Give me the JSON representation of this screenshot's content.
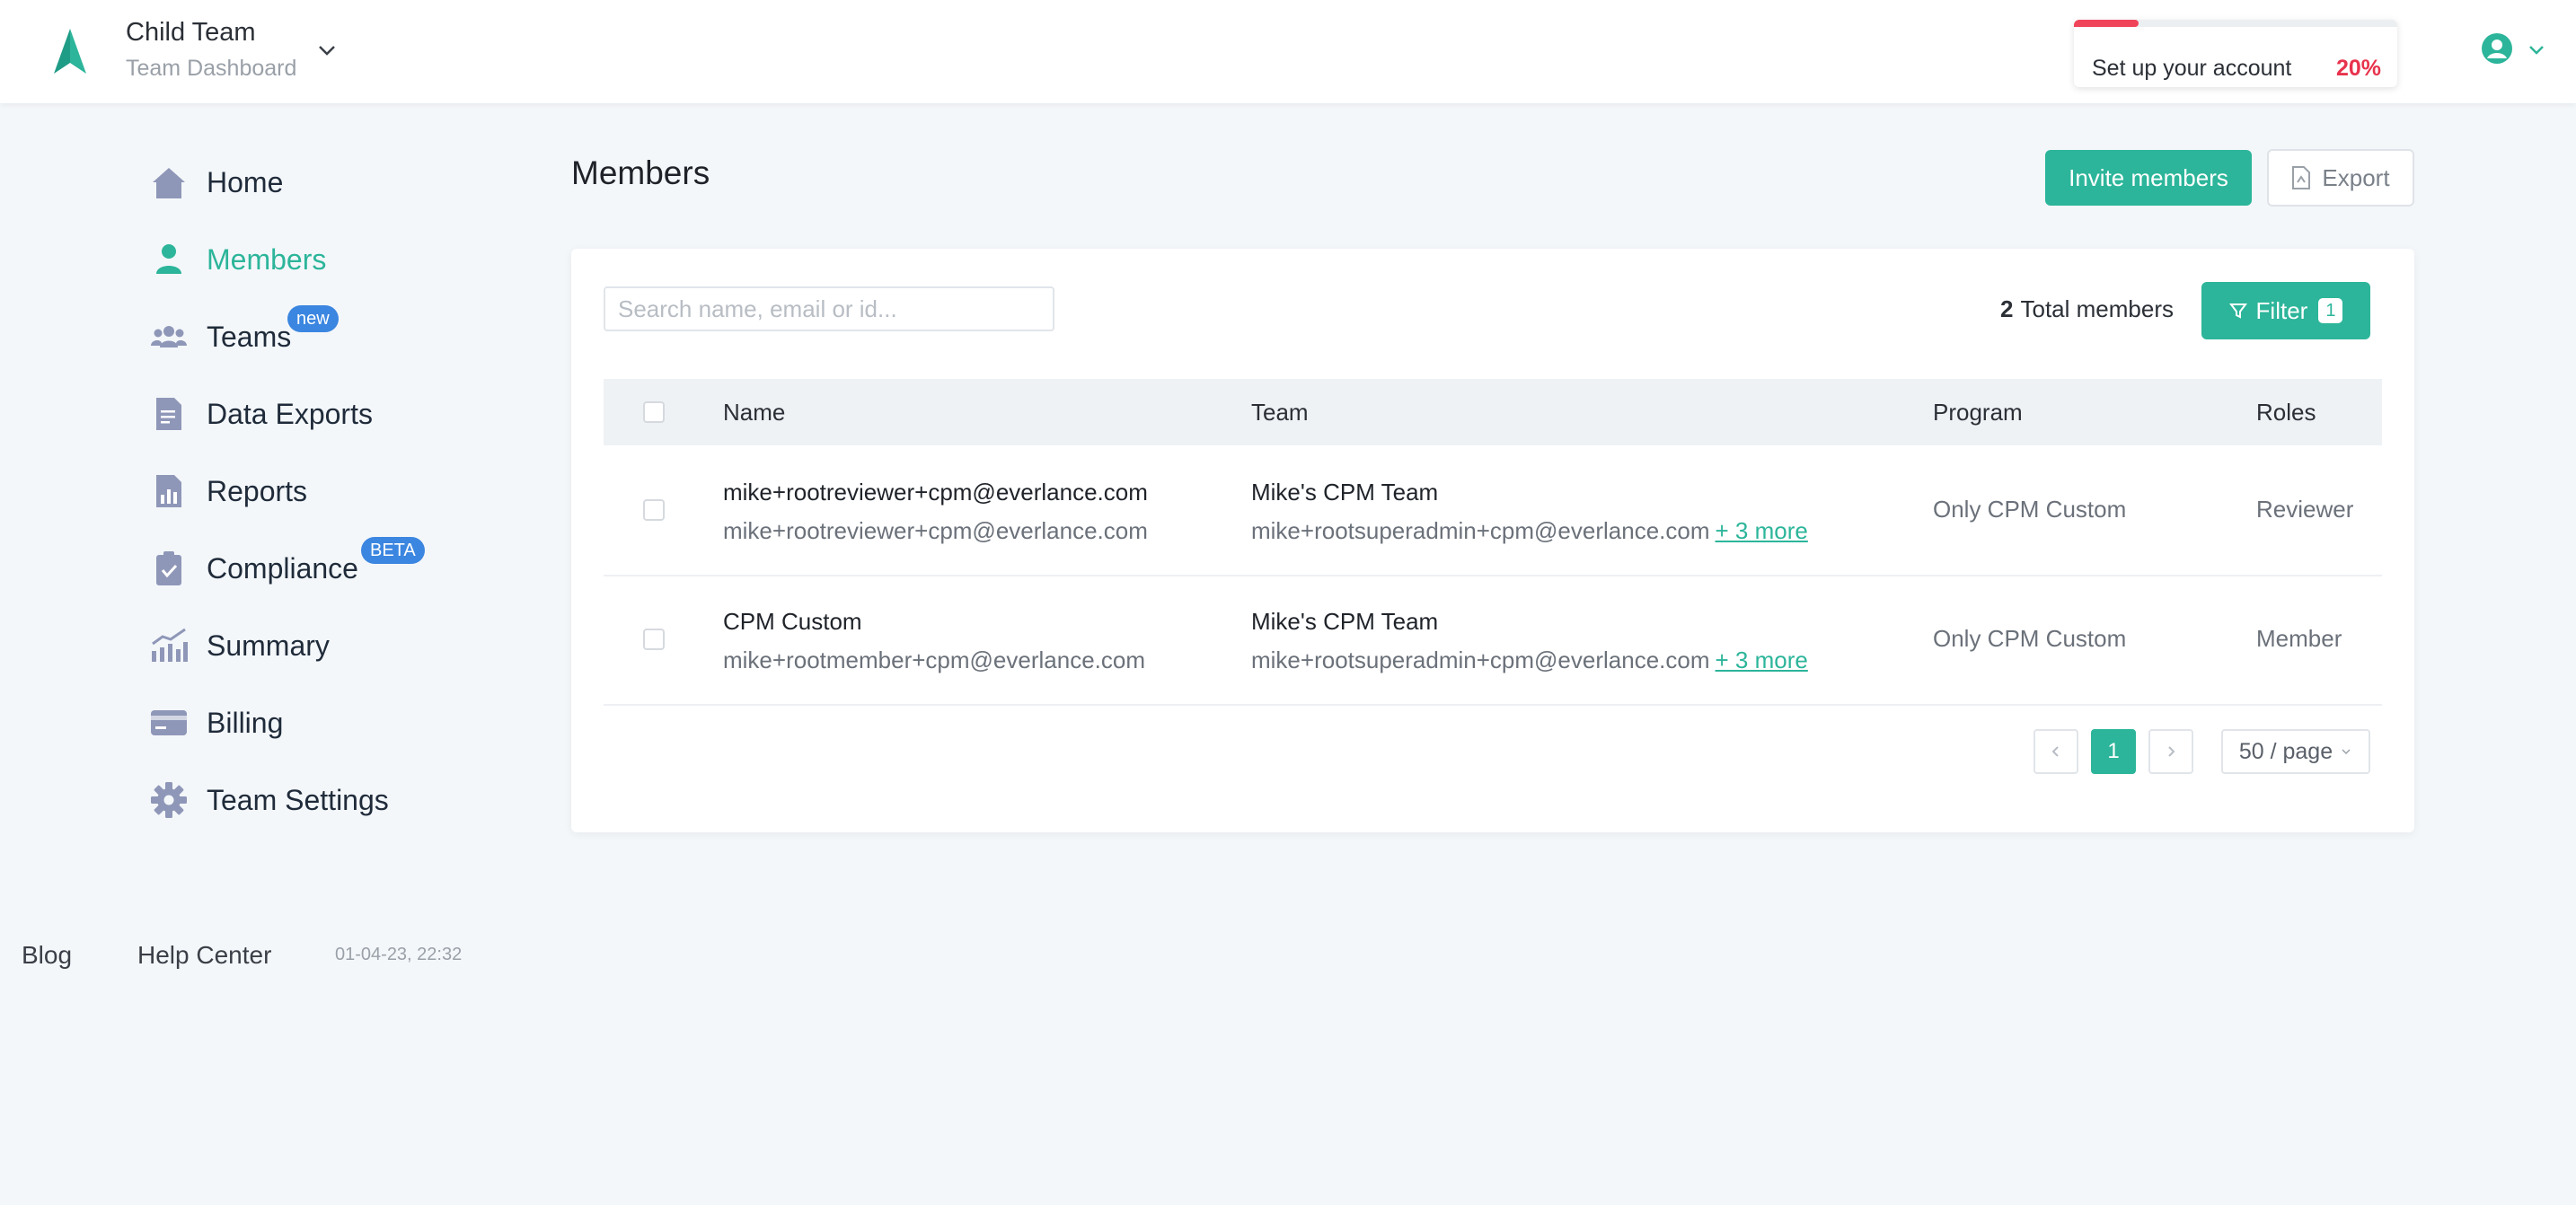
{
  "header": {
    "team_name": "Child Team",
    "team_subtitle": "Team Dashboard",
    "setup": {
      "label": "Set up your account",
      "percent_label": "20%",
      "progress": 0.2
    }
  },
  "sidebar": {
    "items": [
      {
        "label": "Home",
        "icon": "home-icon"
      },
      {
        "label": "Members",
        "icon": "person-icon",
        "active": true
      },
      {
        "label": "Teams",
        "icon": "teams-icon",
        "badge": "new"
      },
      {
        "label": "Data Exports",
        "icon": "document-icon"
      },
      {
        "label": "Reports",
        "icon": "report-icon"
      },
      {
        "label": "Compliance",
        "icon": "clipboard-check-icon",
        "badge": "BETA"
      },
      {
        "label": "Summary",
        "icon": "trend-chart-icon"
      },
      {
        "label": "Billing",
        "icon": "credit-card-icon"
      },
      {
        "label": "Team Settings",
        "icon": "gear-icon"
      }
    ]
  },
  "footer": {
    "blog": "Blog",
    "help": "Help Center",
    "timestamp": "01-04-23, 22:32"
  },
  "main": {
    "title": "Members",
    "invite_label": "Invite members",
    "export_label": "Export",
    "search_placeholder": "Search name, email or id...",
    "total_count": "2",
    "total_label": "Total members",
    "filter_label": "Filter",
    "filter_count": "1",
    "columns": {
      "name": "Name",
      "team": "Team",
      "program": "Program",
      "roles": "Roles"
    },
    "rows": [
      {
        "name": "mike+rootreviewer+cpm@everlance.com",
        "email": "mike+rootreviewer+cpm@everlance.com",
        "team": "Mike's CPM Team",
        "team_email": "mike+rootsuperadmin+cpm@everlance.com",
        "more": "+ 3 more",
        "program": "Only CPM Custom",
        "role": "Reviewer"
      },
      {
        "name": "CPM Custom",
        "email": "mike+rootmember+cpm@everlance.com",
        "team": "Mike's CPM Team",
        "team_email": "mike+rootsuperadmin+cpm@everlance.com",
        "more": "+ 3 more",
        "program": "Only CPM Custom",
        "role": "Member"
      }
    ],
    "pagination": {
      "current_page": "1",
      "page_size": "50 / page"
    }
  },
  "colors": {
    "accent": "#2cb59a",
    "progress": "#f0445b",
    "badge": "#3b86e0",
    "nav_icon": "#8f97b8"
  }
}
